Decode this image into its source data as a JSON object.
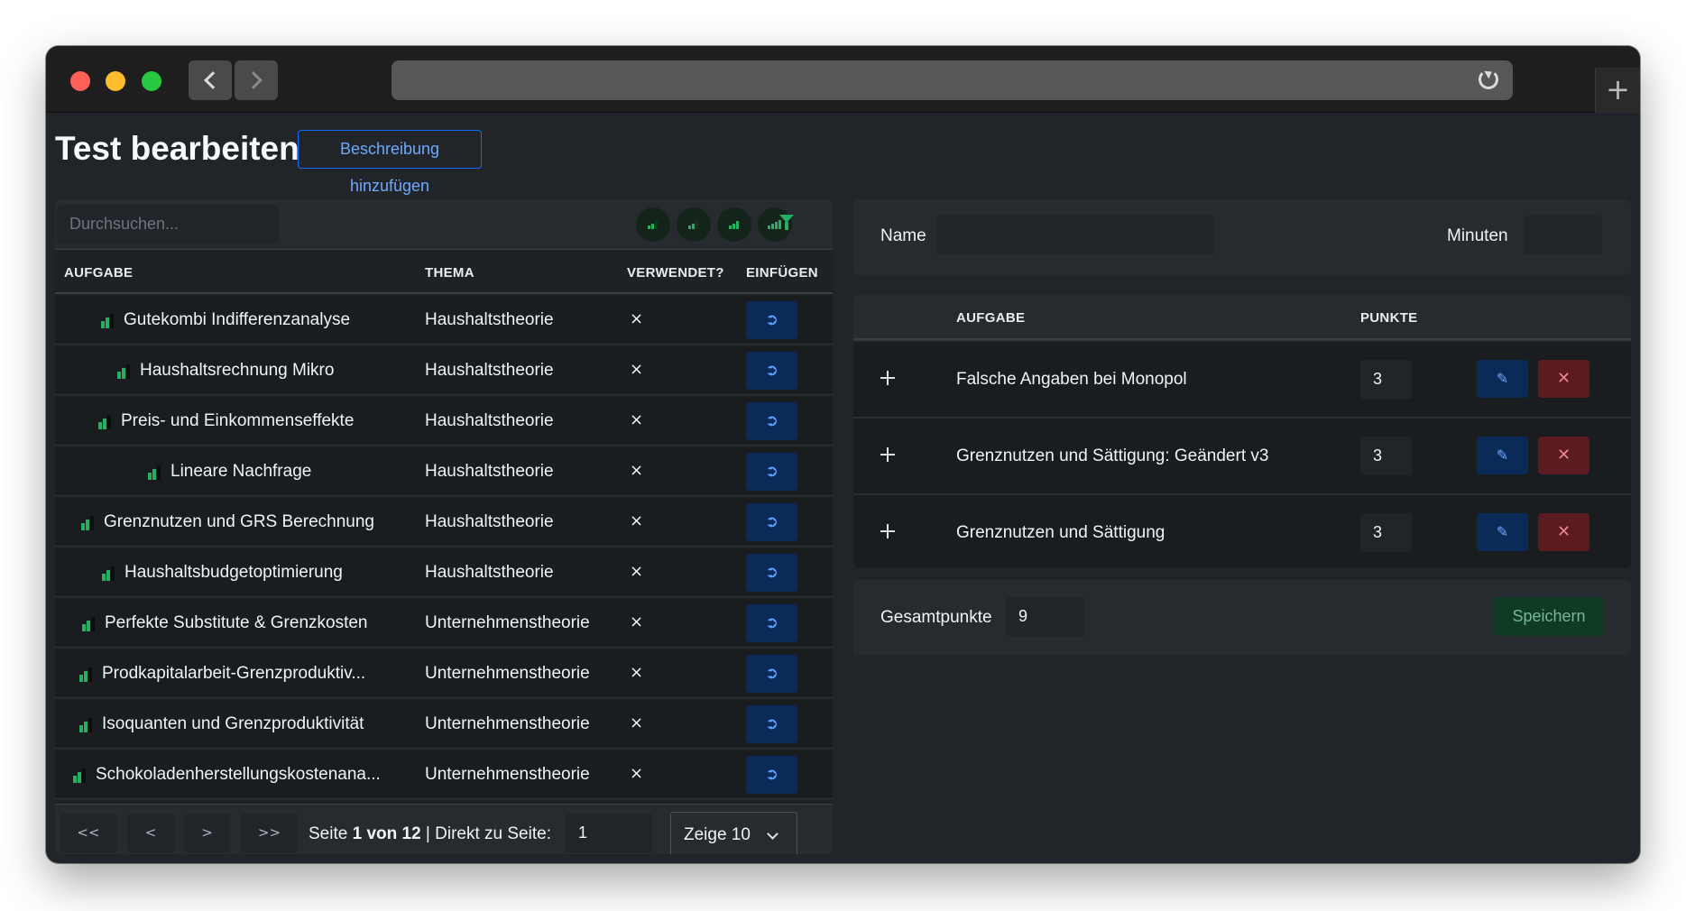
{
  "browser": {
    "back_glyph": "",
    "forward_glyph": "",
    "new_tab": "+"
  },
  "header": {
    "title": "Test bearbeiten",
    "description_button": "Beschreibung hinzufügen"
  },
  "task_table": {
    "search_placeholder": "Durchsuchen...",
    "columns": [
      "AUFGABE",
      "THEMA",
      "VERWENDET?",
      "EINFÜGEN"
    ],
    "rows": [
      {
        "name": "Gutekombi Indifferenzanalyse",
        "topic": "Haushaltstheorie",
        "used": "×",
        "difficulty": 2
      },
      {
        "name": "Haushaltsrechnung Mikro",
        "topic": "Haushaltstheorie",
        "used": "×",
        "difficulty": 2
      },
      {
        "name": "Preis- und Einkommenseffekte",
        "topic": "Haushaltstheorie",
        "used": "×",
        "difficulty": 2
      },
      {
        "name": "Lineare Nachfrage",
        "topic": "Haushaltstheorie",
        "used": "×",
        "difficulty": 2
      },
      {
        "name": "Grenznutzen und GRS Berechnung",
        "topic": "Haushaltstheorie",
        "used": "×",
        "difficulty": 2
      },
      {
        "name": "Haushaltsbudgetoptimierung",
        "topic": "Haushaltstheorie",
        "used": "×",
        "difficulty": 2
      },
      {
        "name": "Perfekte Substitute & Grenzkosten",
        "topic": "Unternehmenstheorie",
        "used": "×",
        "difficulty": 2
      },
      {
        "name": "Prodkapitalarbeit-Grenzproduktiv...",
        "topic": "Unternehmenstheorie",
        "used": "×",
        "difficulty": 2
      },
      {
        "name": "Isoquanten und Grenzproduktivität",
        "topic": "Unternehmenstheorie",
        "used": "×",
        "difficulty": 2
      },
      {
        "name": "Schokoladenherstellungskostenana...",
        "topic": "Unternehmenstheorie",
        "used": "×",
        "difficulty": 2
      }
    ]
  },
  "pagination": {
    "first": "<<",
    "prev": "<",
    "next": ">",
    "last": ">>",
    "page_prefix": "Seite ",
    "current_page": "1",
    "of_label": " von ",
    "total_pages": "12",
    "jump_label": " | Direkt zu Seite:",
    "jump_value": "1",
    "page_size_label": "Zeige 10"
  },
  "test_form": {
    "name_label": "Name",
    "name_value": "",
    "minutes_label": "Minuten",
    "minutes_value": ""
  },
  "selected_tasks": {
    "columns": [
      "AUFGABE",
      "PUNKTE"
    ],
    "rows": [
      {
        "title": "Falsche Angaben bei Monopol",
        "points": "3"
      },
      {
        "title": "Grenznutzen und Sättigung: Geändert v3",
        "points": "3"
      },
      {
        "title": "Grenznutzen und Sättigung",
        "points": "3"
      }
    ]
  },
  "summary": {
    "total_label": "Gesamtpunkte",
    "total_value": "9",
    "save_button": "Speichern"
  },
  "colors": {
    "background": "#212529",
    "accent_blue": "#0d6efd",
    "difficulty_green": "#27ae60",
    "danger": "#dc3545",
    "success": "#198754"
  }
}
